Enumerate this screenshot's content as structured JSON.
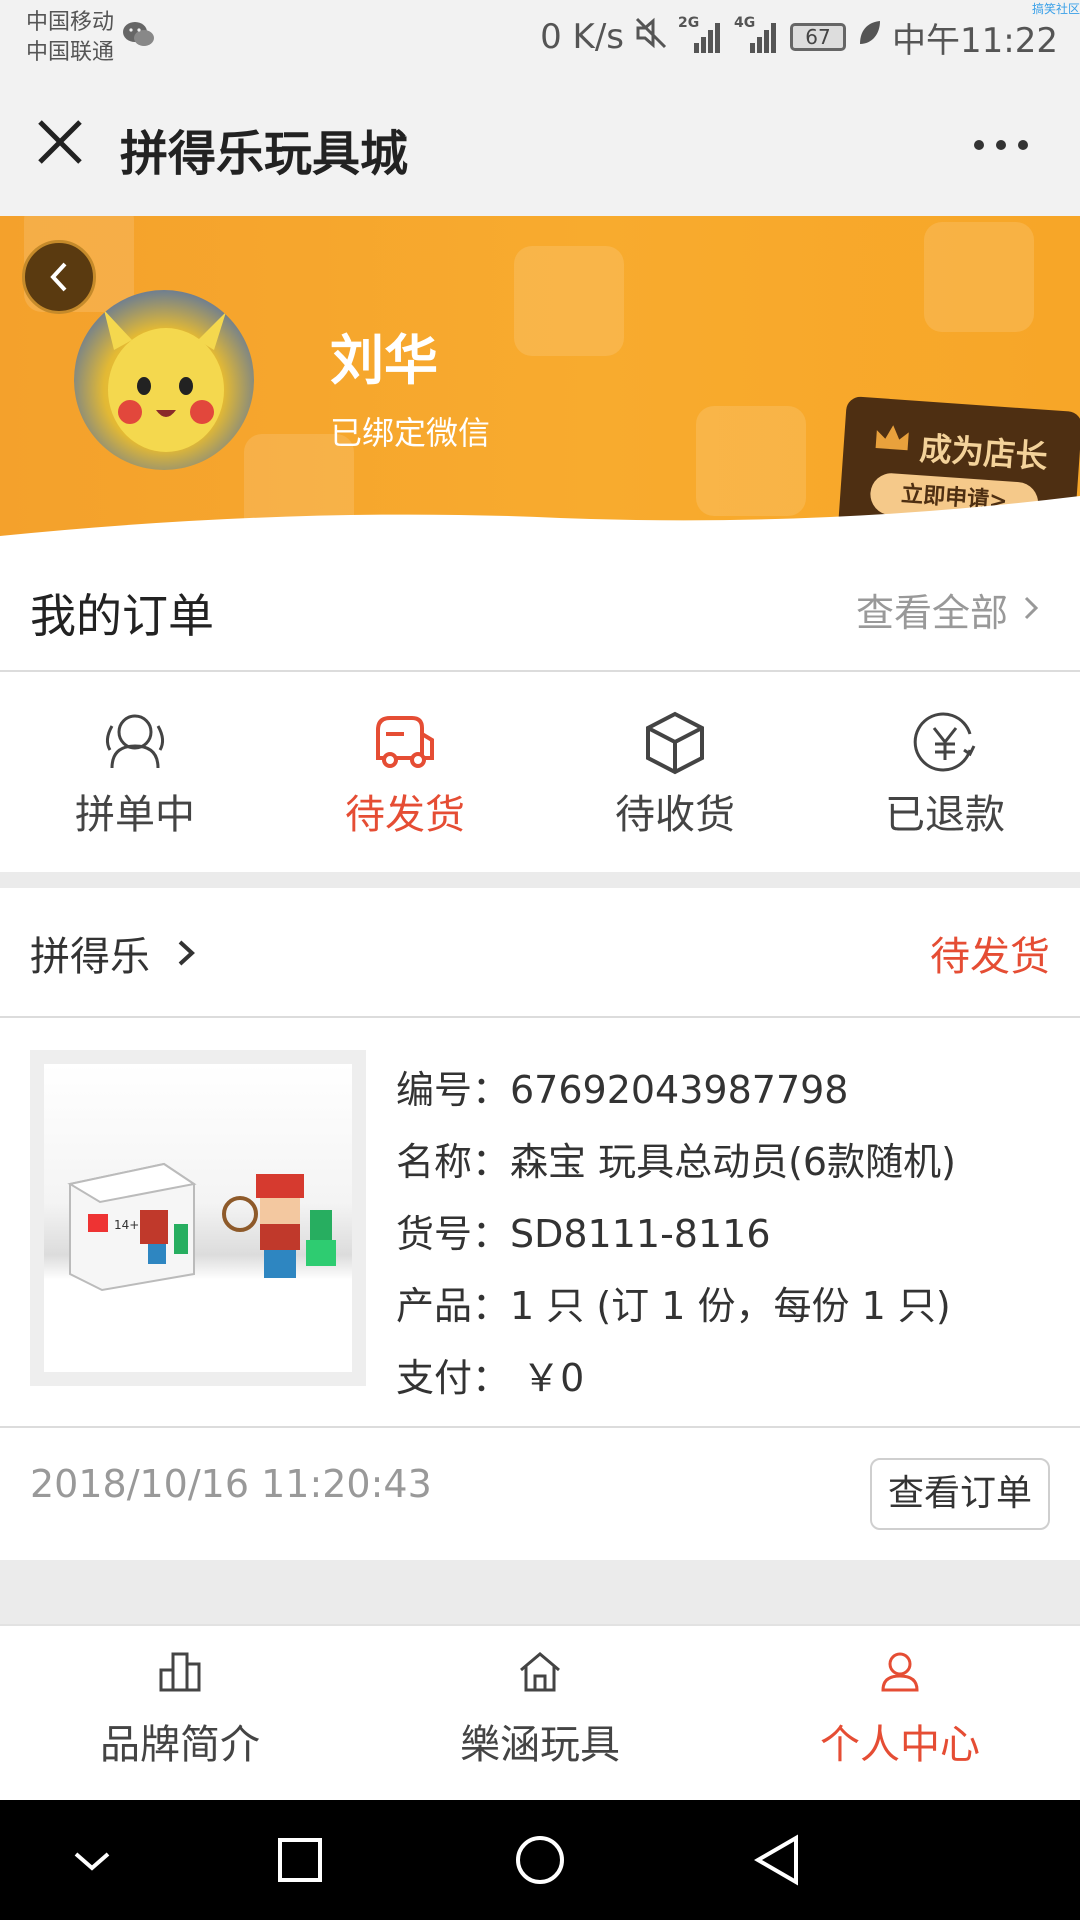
{
  "status_bar": {
    "carrier_1": "中国移动",
    "carrier_2": "中国联通",
    "net_speed": "0 K/s",
    "signal_2g": "2G",
    "signal_4g": "4G",
    "battery": "67",
    "time": "中午11:22",
    "corner_tag": "搞笑社区"
  },
  "nav": {
    "title": "拼得乐玩具城"
  },
  "profile": {
    "name": "刘华",
    "bound_status": "已绑定微信",
    "shop_title": "成为店长",
    "shop_apply": "立即申请>"
  },
  "orders": {
    "title": "我的订单",
    "view_all": "查看全部",
    "tabs": [
      {
        "label": "拼单中",
        "icon": "group-users-icon"
      },
      {
        "label": "待发货",
        "icon": "delivery-truck-icon",
        "active": true
      },
      {
        "label": "待收货",
        "icon": "package-box-icon"
      },
      {
        "label": "已退款",
        "icon": "yuan-refund-icon"
      }
    ]
  },
  "order_card": {
    "store": "拼得乐",
    "state": "待发货",
    "lines": [
      "编号：67692043987798",
      "名称：森宝 玩具总动员(6款随机)",
      "货号：SD8111-8116",
      "产品：1 只 (订 1 份，每份 1 只)",
      "支付： ￥0"
    ],
    "time": "2018/10/16 11:20:43",
    "view_button": "查看订单"
  },
  "bottom_tabs": [
    {
      "label": "品牌简介",
      "icon": "building-icon"
    },
    {
      "label": "樂涵玩具",
      "icon": "home-icon"
    },
    {
      "label": "个人中心",
      "icon": "person-icon",
      "active": true
    }
  ],
  "colors": {
    "accent": "#e54d34",
    "banner": "#f7a52b",
    "shop_card": "#4e2f12"
  }
}
